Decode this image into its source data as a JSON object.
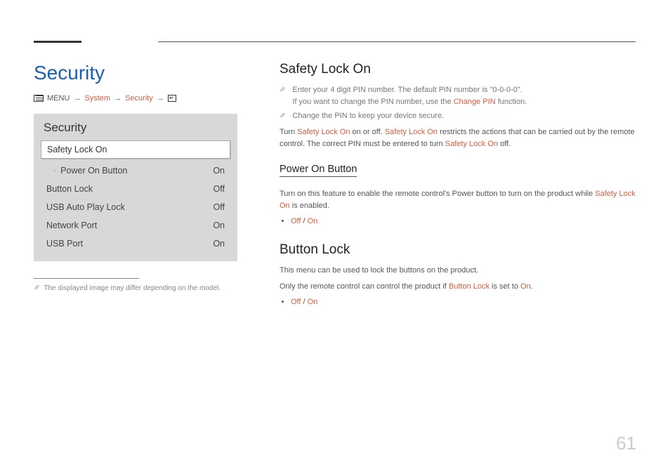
{
  "page": {
    "title": "Security",
    "number": "61"
  },
  "breadcrumb": {
    "menu_label": "MENU",
    "items": [
      "System",
      "Security"
    ]
  },
  "osd": {
    "title": "Security",
    "selected": "Safety Lock On",
    "rows": [
      {
        "label": "Power On Button",
        "value": "On",
        "sub": true
      },
      {
        "label": "Button Lock",
        "value": "Off",
        "sub": false
      },
      {
        "label": "USB Auto Play Lock",
        "value": "Off",
        "sub": false
      },
      {
        "label": "Network Port",
        "value": "On",
        "sub": false
      },
      {
        "label": "USB Port",
        "value": "On",
        "sub": false
      }
    ]
  },
  "footnote": "The displayed image may differ depending on the model.",
  "sections": {
    "safety_lock": {
      "heading": "Safety Lock On",
      "note1_a": "Enter your 4 digit PIN number. The default PIN number is \"0-0-0-0\".",
      "note1_b_prefix": "If you want to change the PIN number, use the ",
      "note1_b_link": "Change PIN",
      "note1_b_suffix": " function.",
      "note2": "Change the PIN to keep your device secure.",
      "body_1": "Turn ",
      "body_2": "Safety Lock On",
      "body_3": " on or off. ",
      "body_4": "Safety Lock On",
      "body_5": " restricts the actions that can be carried out by the remote control. The correct PIN must be entered to turn ",
      "body_6": "Safety Lock On",
      "body_7": " off."
    },
    "power_on": {
      "heading": "Power On Button",
      "body_1": "Turn on this feature to enable the remote control's Power button to turn on the product while ",
      "body_2": "Safety Lock On",
      "body_3": " is enabled.",
      "opts": {
        "off": "Off",
        "sep": " / ",
        "on": "On"
      }
    },
    "button_lock": {
      "heading": "Button Lock",
      "body_a": "This menu can be used to lock the buttons on the product.",
      "body_b_1": "Only the remote control can control the product if ",
      "body_b_2": "Button Lock",
      "body_b_3": " is set to ",
      "body_b_4": "On",
      "body_b_5": ".",
      "opts": {
        "off": "Off",
        "sep": " / ",
        "on": "On"
      }
    }
  }
}
